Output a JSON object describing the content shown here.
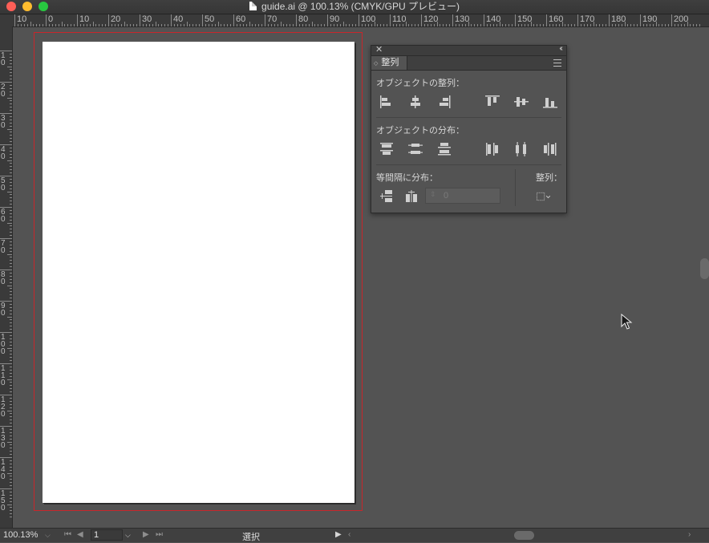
{
  "window": {
    "title": "guide.ai @ 100.13% (CMYK/GPU プレビュー)"
  },
  "rulers": {
    "horizontal": [
      "10",
      "0",
      "10",
      "20",
      "30",
      "40",
      "50",
      "60",
      "70",
      "80",
      "90",
      "100",
      "110",
      "120",
      "130",
      "140",
      "150",
      "160",
      "170",
      "180",
      "190",
      "200"
    ],
    "vertical": [
      "1\n0",
      "2\n0",
      "3\n0",
      "4\n0",
      "5\n0",
      "6\n0",
      "7\n0",
      "8\n0",
      "9\n0",
      "1\n0\n0",
      "1\n1\n0",
      "1\n2\n0",
      "1\n3\n0",
      "1\n4\n0",
      "1\n5\n0"
    ]
  },
  "panel": {
    "tab_label": "整列",
    "align_objects_label": "オブジェクトの整列：",
    "distribute_objects_label": "オブジェクトの分布：",
    "distribute_spacing_label": "等間隔に分布：",
    "align_to_label": "整列：",
    "spacing_value": "0"
  },
  "statusbar": {
    "zoom": "100.13%",
    "artboard_number": "1",
    "current_tool": "選択"
  },
  "colors": {
    "bleed": "#c8262b",
    "canvas": "#535353",
    "artboard": "#ffffff"
  }
}
